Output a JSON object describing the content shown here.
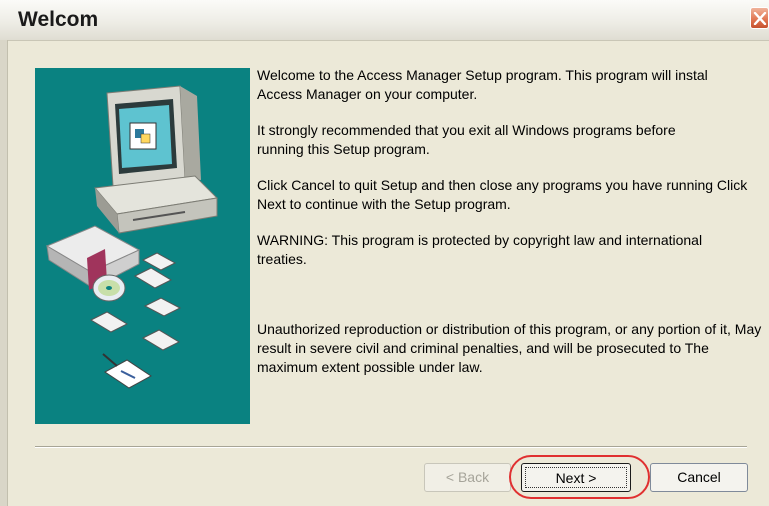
{
  "window": {
    "title": "Welcom"
  },
  "colors": {
    "art_background": "#0a8281",
    "highlight": "#e03030",
    "close": "#e0734f"
  },
  "illustration": {
    "icon_name": "setup-computer-disks-illustration"
  },
  "paragraphs": [
    "Welcome to the Access Manager Setup program. This program will instal Access Manager on your computer.",
    "It strongly recommended that you exit all Windows programs before running this Setup program.",
    "Click Cancel to quit Setup and then close any programs you have running Click Next to continue with the Setup program.",
    "WARNING: This program is protected by copyright law and international treaties.",
    "Unauthorized reproduction or distribution of this program, or any portion of it, May result in severe civil and criminal penalties, and will be prosecuted to The maximum extent possible under law."
  ],
  "buttons": {
    "back": "< Back",
    "next": "Next >",
    "cancel": "Cancel"
  }
}
